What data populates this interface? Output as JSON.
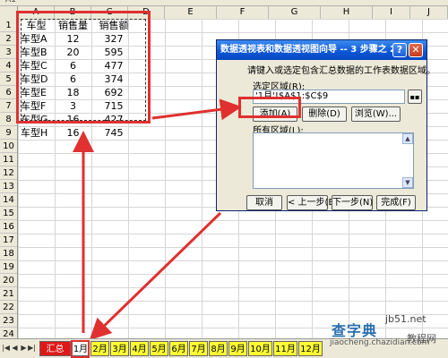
{
  "name_box": "A1",
  "columns": [
    "A",
    "B",
    "C",
    "D",
    "E",
    "F",
    "G",
    "H",
    "I",
    "J"
  ],
  "rows": [
    "1",
    "2",
    "3",
    "4",
    "5",
    "6",
    "7",
    "8",
    "9",
    "10",
    "11",
    "12",
    "13",
    "14",
    "15",
    "16",
    "17",
    "18",
    "19",
    "20",
    "21",
    "22",
    "23",
    "24"
  ],
  "table": {
    "headers": [
      "车型",
      "销售量",
      "销售额"
    ],
    "rows": [
      [
        "车型A",
        "12",
        "327"
      ],
      [
        "车型B",
        "20",
        "595"
      ],
      [
        "车型C",
        "6",
        "477"
      ],
      [
        "车型D",
        "6",
        "374"
      ],
      [
        "车型E",
        "18",
        "692"
      ],
      [
        "车型F",
        "3",
        "715"
      ],
      [
        "车型G",
        "16",
        "427"
      ],
      [
        "车型H",
        "16",
        "745"
      ]
    ]
  },
  "dialog": {
    "title": "数据透视表和数据透视图向导 -- 3 步骤之 2b",
    "help_glyph": "?",
    "close_glyph": "✕",
    "instruction": "请键入或选定包含汇总数据的工作表数据区域。",
    "range_label": "选定区域(R):",
    "range_value": "'1月'!$A$1:$C$9",
    "add_button": "添加(A)",
    "delete_button": "删除(D)",
    "browse_button": "浏览(W)...",
    "all_ranges_label": "所有区域(L):",
    "cancel_button": "取消",
    "back_button": "< 上一步(B)",
    "next_button": "下一步(N) >",
    "finish_button": "完成(F)"
  },
  "sheet_tabs": [
    "汇总",
    "1月",
    "2月",
    "3月",
    "4月",
    "5月",
    "6月",
    "7月",
    "8月",
    "9月",
    "10月",
    "11月",
    "12月"
  ],
  "active_tab": "1月",
  "watermark": {
    "line1": "查字典",
    "line2": "jb51.net",
    "line3": "jiaocheng.chazidian.com",
    "line4": "教程网"
  },
  "colors": {
    "highlight": "#e03030",
    "tab_yellow": "#ffff33",
    "title_blue": "#0b56d4"
  }
}
